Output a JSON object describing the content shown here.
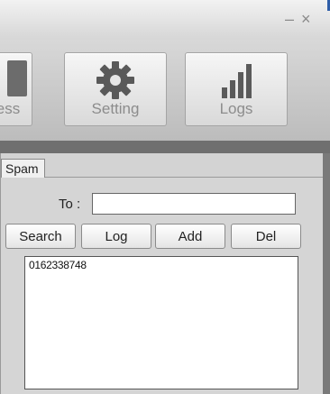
{
  "window": {
    "minimize": "–",
    "close": "×"
  },
  "toolbar": {
    "buttons": [
      {
        "label": "ess",
        "icon": "document-icon"
      },
      {
        "label": "Setting",
        "icon": "gear-icon"
      },
      {
        "label": "Logs",
        "icon": "bar-chart-icon"
      }
    ]
  },
  "tabs": [
    {
      "label": "Spam"
    }
  ],
  "form": {
    "to_label": "To :",
    "to_value": ""
  },
  "actions": {
    "search": "Search",
    "log": "Log",
    "add": "Add",
    "del": "Del"
  },
  "list": {
    "items": [
      "0162338748"
    ]
  }
}
